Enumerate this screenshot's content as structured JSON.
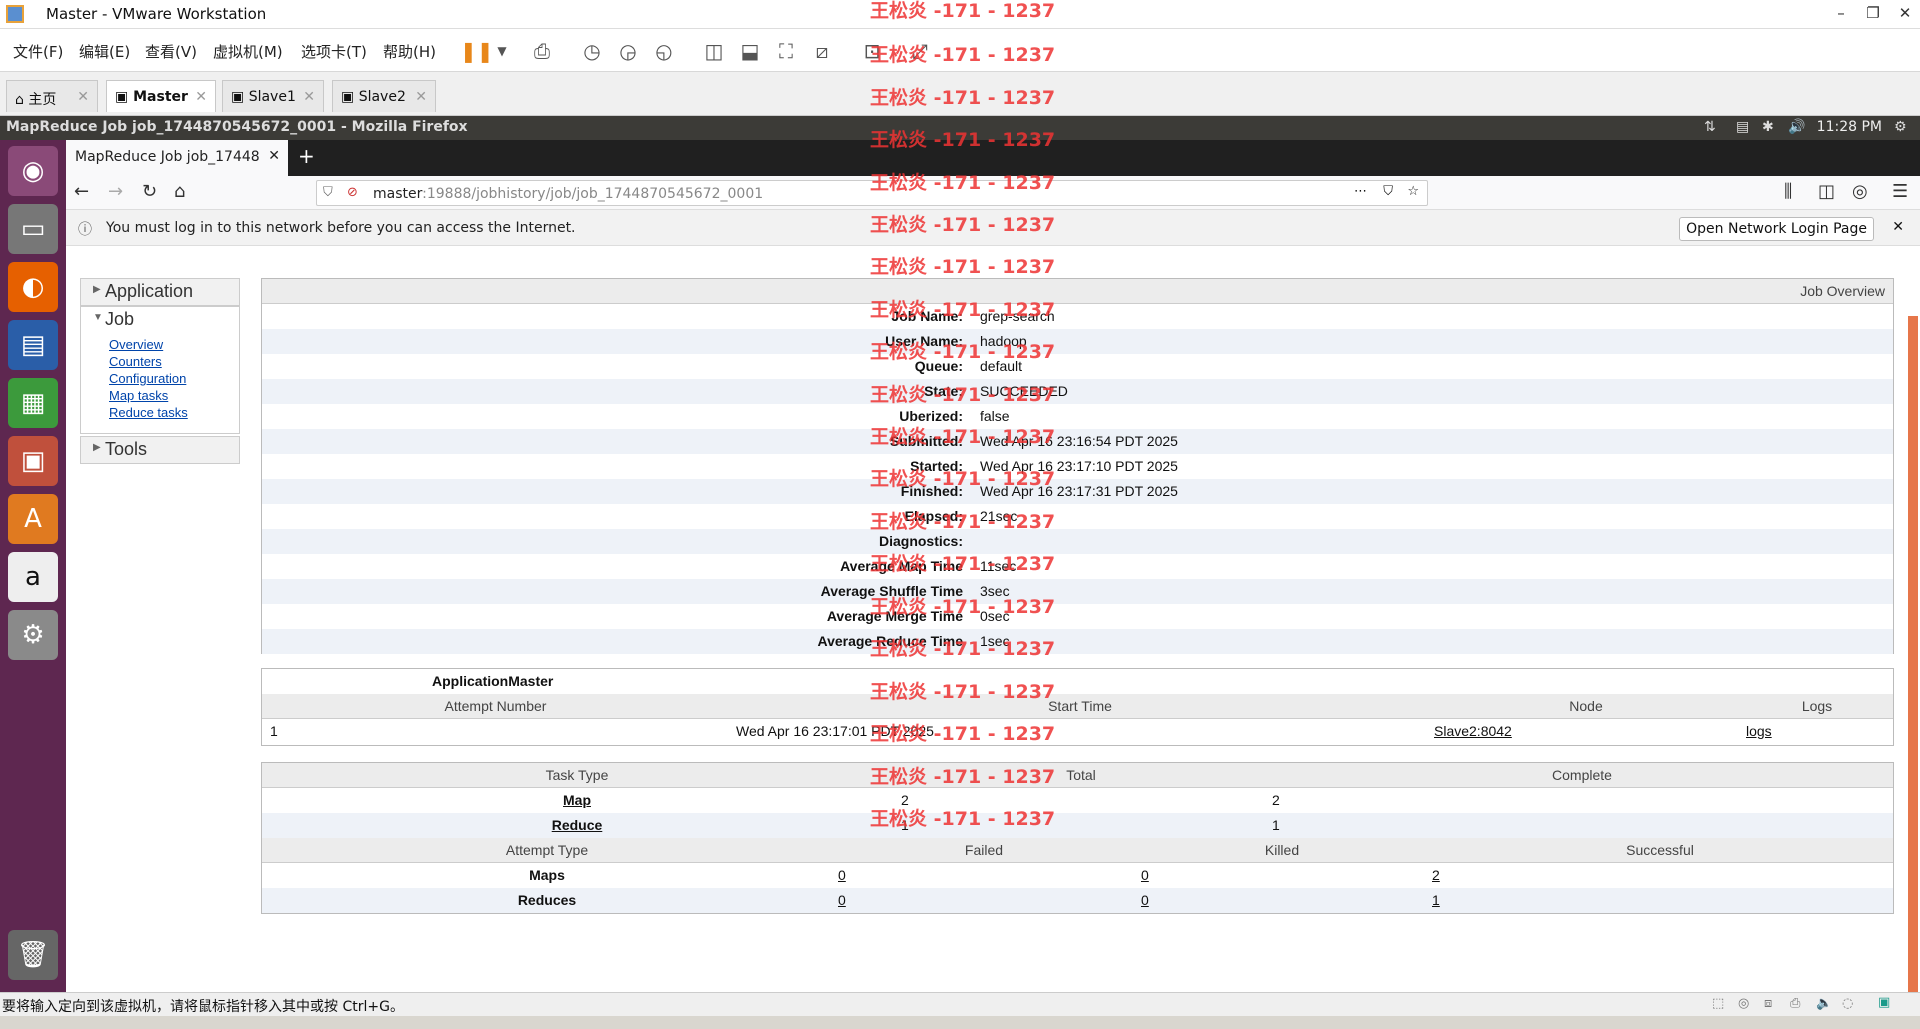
{
  "vmware": {
    "window_title": "Master - VMware Workstation",
    "menu": [
      "文件(F)",
      "编辑(E)",
      "查看(V)",
      "虚拟机(M)",
      "选项卡(T)",
      "帮助(H)"
    ],
    "tabs": [
      {
        "label": "主页"
      },
      {
        "label": "Master"
      },
      {
        "label": "Slave1"
      },
      {
        "label": "Slave2"
      }
    ],
    "status_text": "要将输入定向到该虚拟机，请将鼠标指针移入其中或按 Ctrl+G。"
  },
  "ubuntu": {
    "window_title": "MapReduce Job job_1744870545672_0001 - Mozilla Firefox",
    "clock": "11:28 PM"
  },
  "firefox": {
    "tab_title": "MapReduce Job job_17448",
    "url_host": "master",
    "url_rest": ":19888/jobhistory/job/job_1744870545672_0001",
    "notice": "You must log in to this network before you can access the Internet.",
    "notice_button": "Open Network Login Page"
  },
  "nav": {
    "application": "Application",
    "job": "Job",
    "job_links": [
      "Overview",
      "Counters",
      "Configuration",
      "Map tasks",
      "Reduce tasks"
    ],
    "tools": "Tools"
  },
  "overview": {
    "header": "Job Overview",
    "rows": [
      {
        "label": "Job Name:",
        "value": "grep-search"
      },
      {
        "label": "User Name:",
        "value": "hadoop"
      },
      {
        "label": "Queue:",
        "value": "default"
      },
      {
        "label": "State:",
        "value": "SUCCEEDED"
      },
      {
        "label": "Uberized:",
        "value": "false"
      },
      {
        "label": "Submitted:",
        "value": "Wed Apr 16 23:16:54 PDT 2025"
      },
      {
        "label": "Started:",
        "value": "Wed Apr 16 23:17:10 PDT 2025"
      },
      {
        "label": "Finished:",
        "value": "Wed Apr 16 23:17:31 PDT 2025"
      },
      {
        "label": "Elapsed:",
        "value": "21sec"
      },
      {
        "label": "Diagnostics:",
        "value": ""
      },
      {
        "label": "Average Map Time",
        "value": "11sec"
      },
      {
        "label": "Average Shuffle Time",
        "value": "3sec"
      },
      {
        "label": "Average Merge Time",
        "value": "0sec"
      },
      {
        "label": "Average Reduce Time",
        "value": "1sec"
      }
    ]
  },
  "am": {
    "title": "ApplicationMaster",
    "headers": [
      "Attempt Number",
      "Start Time",
      "Node",
      "Logs"
    ],
    "row": {
      "attempt": "1",
      "start": "Wed Apr 16 23:17:01 PDT 2025",
      "node": "Slave2:8042",
      "logs": "logs"
    }
  },
  "tasks": {
    "headers": [
      "Task Type",
      "Total",
      "Complete"
    ],
    "rows": [
      {
        "type": "Map",
        "total": "2",
        "complete": "2"
      },
      {
        "type": "Reduce",
        "total": "1",
        "complete": "1"
      }
    ],
    "attempt_headers": [
      "Attempt Type",
      "Failed",
      "Killed",
      "Successful"
    ],
    "attempt_rows": [
      {
        "type": "Maps",
        "failed": "0",
        "killed": "0",
        "successful": "2"
      },
      {
        "type": "Reduces",
        "failed": "0",
        "killed": "0",
        "successful": "1"
      }
    ]
  },
  "watermark": "王松炎 -171 - 1237",
  "colors": {
    "launcher": "#5e2750",
    "ubuntu_bar": "#3c3b37",
    "watermark": "#ee3333"
  }
}
